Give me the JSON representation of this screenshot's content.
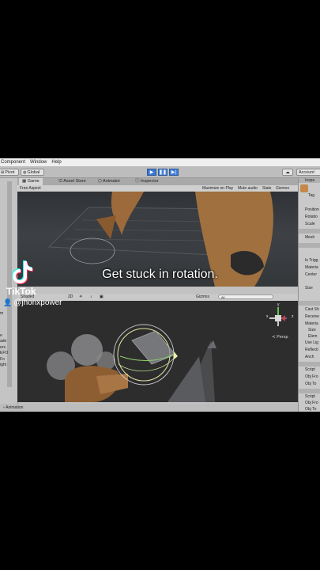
{
  "menu": {
    "items": [
      "Component",
      "Window",
      "Help"
    ]
  },
  "toolbar": {
    "pivot_label": "Pivot",
    "global_label": "Global",
    "play_icon": "play-icon",
    "pause_icon": "pause-icon",
    "step_icon": "step-icon",
    "account_label": "Account"
  },
  "tabs": {
    "game": "Game",
    "asset_store": "Asset Store",
    "animator": "Animator",
    "inspector_tab": "Inspector"
  },
  "gamebar": {
    "aspect": "Free Aspect",
    "maximize": "Maximize on Play",
    "mute": "Mute audio",
    "stats": "Stats",
    "gizmos": "Gizmos"
  },
  "scenebar": {
    "shaded": "Shaded",
    "mode_2d": "2D",
    "gizmos": "Gizmos",
    "search": "All"
  },
  "scene": {
    "persp": "Persp",
    "axis_x": "x",
    "axis_y": "y",
    "axis_z": "z"
  },
  "left_panel": {
    "items": [
      "m",
      "e",
      "ade",
      "ers",
      "EFO",
      "Fo",
      "ight"
    ]
  },
  "inspector": {
    "header": "Inspe",
    "tag": "Tag",
    "lines": [
      "Position",
      "Rotatio",
      "Scale",
      "Mesh",
      "Is Trigg",
      "Materia",
      "Center",
      "Size",
      "Cast Sh",
      "Receive",
      "Materia",
      "Size",
      "Elem",
      "Use Lig",
      "Reflecti",
      "Anch",
      "Script",
      "Obj Fro",
      "Obj To",
      "Script",
      "Obj Fro",
      "Obj To"
    ]
  },
  "statusbar": {
    "text": "Animation"
  },
  "caption": "Get stuck in rotation.",
  "tiktok": {
    "brand": "TikTok",
    "handle": "@jhonxpower"
  }
}
